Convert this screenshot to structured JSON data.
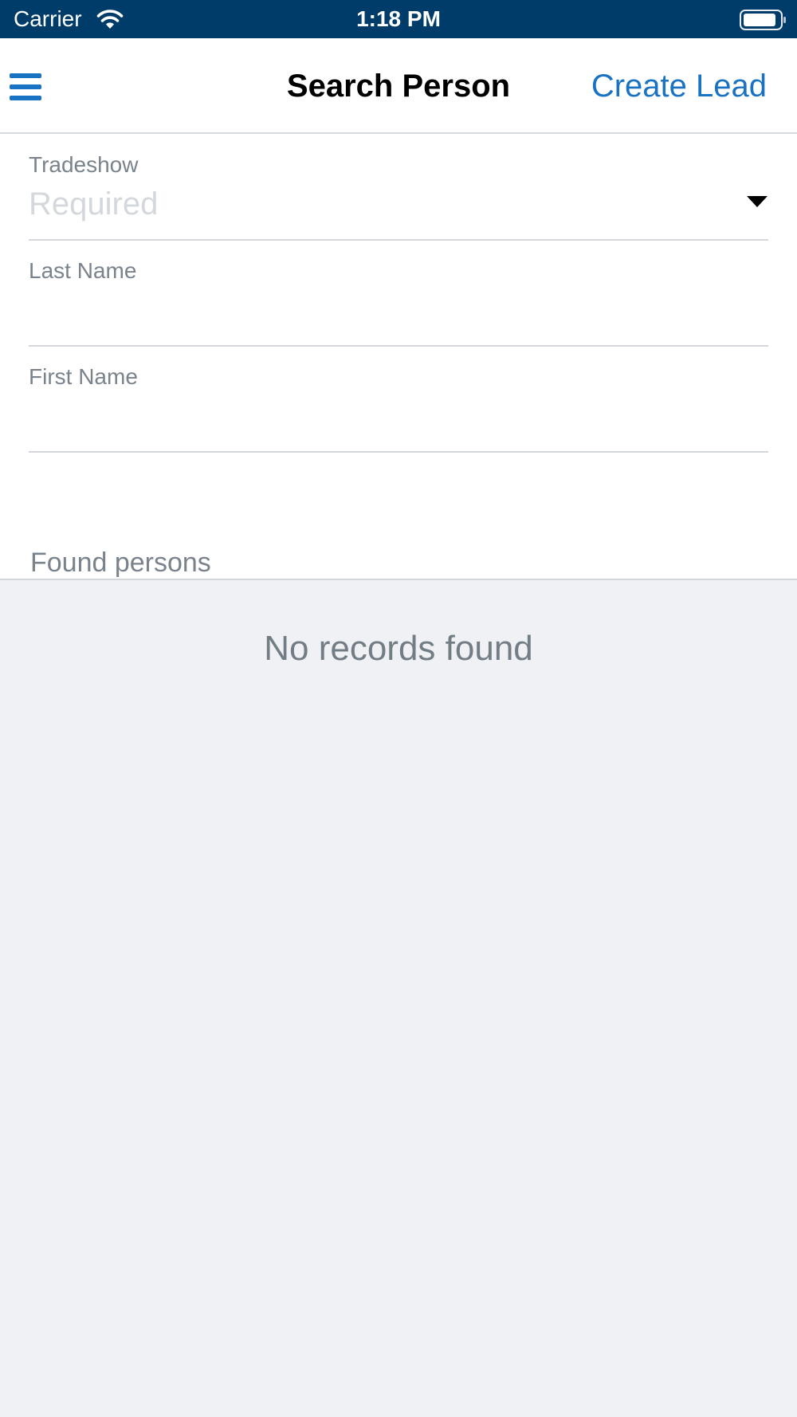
{
  "status_bar": {
    "carrier": "Carrier",
    "time": "1:18 PM",
    "wifi_icon": "wifi-icon",
    "battery_icon": "battery-icon"
  },
  "header": {
    "menu_icon": "hamburger-menu-icon",
    "title": "Search Person",
    "create_lead_label": "Create Lead"
  },
  "form": {
    "tradeshow": {
      "label": "Tradeshow",
      "placeholder": "Required",
      "value": "",
      "icon": "dropdown-triangle-icon"
    },
    "last_name": {
      "label": "Last Name",
      "placeholder": "",
      "value": ""
    },
    "first_name": {
      "label": "First Name",
      "placeholder": "",
      "value": ""
    }
  },
  "results": {
    "header": "Found persons",
    "empty_message": "No records found"
  },
  "colors": {
    "status_bar_bg": "#003c6a",
    "accent": "#1a73c2",
    "results_bg": "#eff1f5",
    "label_gray": "#7a838c"
  }
}
